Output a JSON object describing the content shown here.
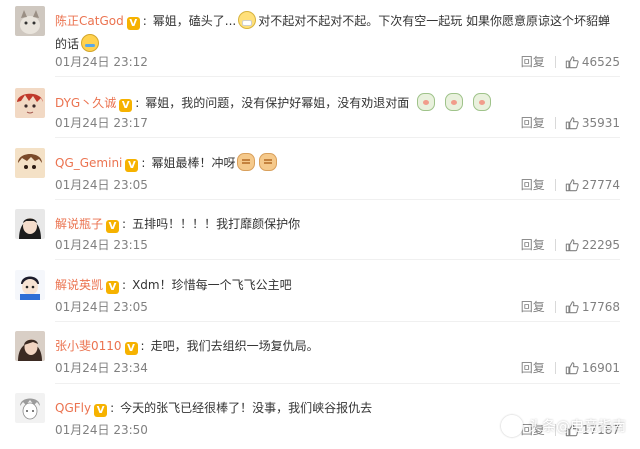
{
  "colors": {
    "username": "#eb7350",
    "meta": "#808080",
    "vip_badge": "#f6b200",
    "text": "#333333"
  },
  "reply_label": "回复",
  "comments": [
    {
      "username": "陈正CatGod",
      "badge": "V",
      "parts": [
        "幂姐，磕头了...",
        "对不起对不起对不起。下次有空一起玩 如果你愿意原谅这个坏貂蝉的话"
      ],
      "emojis": [
        "mask-icon",
        "teary-face-icon"
      ],
      "time": "01月24日 23:12",
      "likes": "46525"
    },
    {
      "username": "DYG丶久诚",
      "badge": "V",
      "parts": [
        "幂姐，我的问题，没有保护好幂姐，没有劝退对面"
      ],
      "emojis": [
        "bunny-icon",
        "bunny-icon",
        "bunny-icon"
      ],
      "time": "01月24日 23:17",
      "likes": "35931"
    },
    {
      "username": "QG_Gemini",
      "badge": "V",
      "parts": [
        "幂姐最棒！冲呀"
      ],
      "emojis": [
        "fist-icon",
        "fist-icon"
      ],
      "time": "01月24日 23:05",
      "likes": "27774"
    },
    {
      "username": "解说瓶子",
      "badge": "V",
      "parts": [
        "五排吗！！！！我打靡颜保护你"
      ],
      "emojis": [],
      "time": "01月24日 23:15",
      "likes": "22295"
    },
    {
      "username": "解说英凯",
      "badge": "V",
      "parts": [
        "Xdm！珍惜每一个飞飞公主吧"
      ],
      "emojis": [],
      "time": "01月24日 23:05",
      "likes": "17768"
    },
    {
      "username": "张小斐0110",
      "badge": "V",
      "parts": [
        "走吧，我们去组织一场复仇局。"
      ],
      "emojis": [],
      "time": "01月24日 23:34",
      "likes": "16901"
    },
    {
      "username": "QGFly",
      "badge": "V",
      "parts": [
        "今天的张飞已经很棒了！没事，我们峡谷报仇去"
      ],
      "emojis": [],
      "time": "01月24日 23:50",
      "likes": "17187"
    }
  ],
  "watermark": "头条@电竞指南"
}
